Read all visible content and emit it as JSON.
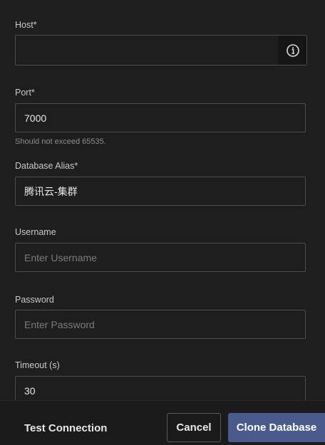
{
  "form": {
    "host": {
      "label": "Host*",
      "value": "",
      "info_icon": "info-circle-icon"
    },
    "port": {
      "label": "Port*",
      "value": "7000",
      "hint": "Should not exceed 65535."
    },
    "alias": {
      "label": "Database Alias*",
      "value": "腾讯云-集群"
    },
    "username": {
      "label": "Username",
      "value": "",
      "placeholder": "Enter Username"
    },
    "password": {
      "label": "Password",
      "value": "",
      "placeholder": "Enter Password"
    },
    "timeout": {
      "label": "Timeout (s)",
      "value": "30"
    }
  },
  "footer": {
    "test_label": "Test Connection",
    "cancel_label": "Cancel",
    "clone_label": "Clone Database"
  },
  "colors": {
    "background": "#1e1e1e",
    "primary_button": "#4a5a8c",
    "border": "#4d4d4d"
  }
}
